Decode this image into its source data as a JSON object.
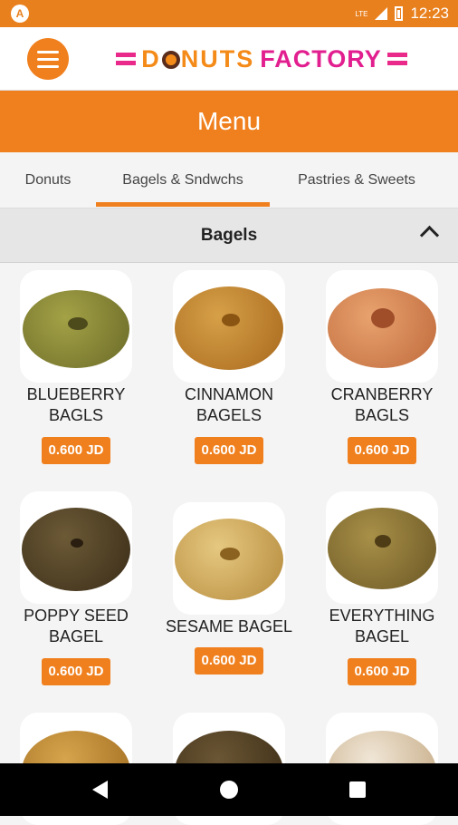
{
  "status": {
    "network": "LTE",
    "time": "12:23",
    "left_icon": "A"
  },
  "header": {
    "brand_a": "D",
    "brand_b": "NUTS",
    "brand_c": "FACTORY",
    "page_title": "Menu"
  },
  "tabs": [
    {
      "label": "Donuts"
    },
    {
      "label": "Bagels & Sndwchs"
    },
    {
      "label": "Pastries & Sweets"
    }
  ],
  "section": {
    "title": "Bagels"
  },
  "items": [
    {
      "name": "BLUEBERRY\nBAGLS",
      "price": "0.600 JD",
      "color": "#8a8a3c"
    },
    {
      "name": "CINNAMON\nBAGELS",
      "price": "0.600 JD",
      "color": "#c58a2f"
    },
    {
      "name": "CRANBERRY\nBAGLS",
      "price": "0.600 JD",
      "color": "#d08a5a"
    },
    {
      "name": "POPPY SEED\nBAGEL",
      "price": "0.600 JD",
      "color": "#5a4a2c"
    },
    {
      "name": "SESAME BAGEL",
      "price": "0.600 JD",
      "color": "#d4b06a"
    },
    {
      "name": "EVERYTHING\nBAGEL",
      "price": "0.600 JD",
      "color": "#8c7a3c"
    }
  ],
  "colors": {
    "accent": "#f0801e",
    "brand_pink": "#e21f8f"
  }
}
